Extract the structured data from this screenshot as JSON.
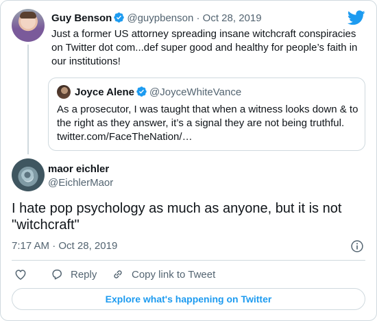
{
  "colors": {
    "brand_blue": "#1d9bf0",
    "text_primary": "#0f1419",
    "text_muted": "#536471",
    "border": "#cfd9de"
  },
  "parent_tweet": {
    "name": "Guy Benson",
    "handle": "@guypbenson",
    "separator": "·",
    "date": "Oct 28, 2019",
    "text": "Just a former US attorney spreading insane witchcraft conspiracies on Twitter dot com...def super good and healthy for people’s faith in our institutions!",
    "verified_icon": "verified-badge-icon",
    "avatar_icon": "avatar"
  },
  "quoted_tweet": {
    "name": "Joyce Alene",
    "handle": "@JoyceWhiteVance",
    "text": "As a prosecutor, I was taught that when a witness looks down & to the right as they answer, it’s a signal they are not being truthful. twitter.com/FaceTheNation/…",
    "verified_icon": "verified-badge-icon"
  },
  "main_tweet": {
    "name": "maor eichler",
    "handle": "@EichlerMaor",
    "text": "I hate pop psychology as much as anyone, but it is not \"witchcraft\"",
    "time": "7:17 AM",
    "separator": "·",
    "date": "Oct 28, 2019"
  },
  "actions": {
    "reply_label": "Reply",
    "copy_link_label": "Copy link to Tweet",
    "like_icon": "heart-icon",
    "reply_icon": "reply-icon",
    "copy_icon": "link-icon",
    "info_icon": "info-icon"
  },
  "footer": {
    "explore_label": "Explore what's happening on Twitter"
  },
  "branding": {
    "logo_icon": "twitter-bird-icon"
  }
}
